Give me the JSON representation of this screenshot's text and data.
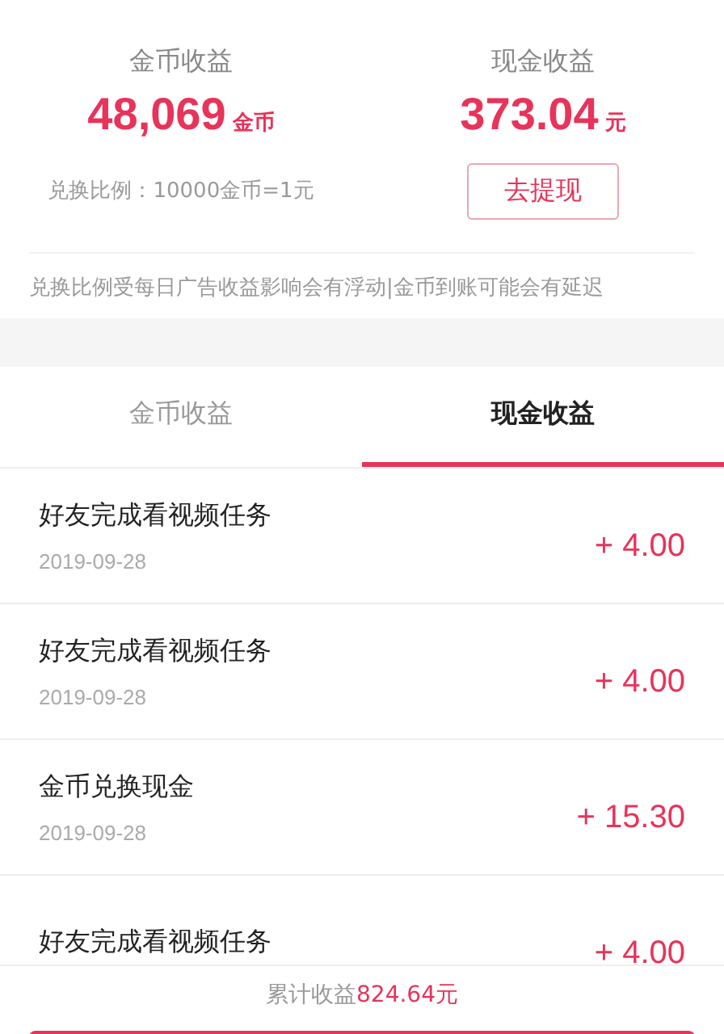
{
  "summary": [
    {
      "title": "金币收益",
      "amount": "48,069",
      "unit": "金币"
    },
    {
      "title": "现金收益",
      "amount": "373.04",
      "unit": "元"
    }
  ],
  "exchange_rate": "兑换比例：10000金币=1元",
  "withdraw_button": "去提现",
  "notice": "兑换比例受每日广告收益影响会有浮动|金币到账可能会有延迟",
  "tabs": [
    {
      "label": "金币收益",
      "selected": false
    },
    {
      "label": "现金收益",
      "selected": true
    }
  ],
  "records": [
    {
      "title": "好友完成看视频任务",
      "date": "2019-09-28",
      "amount": "+ 4.00"
    },
    {
      "title": "好友完成看视频任务",
      "date": "2019-09-28",
      "amount": "+ 4.00"
    },
    {
      "title": "金币兑换现金",
      "date": "2019-09-28",
      "amount": "+ 15.30"
    },
    {
      "title": "好友完成看视频任务",
      "amount": "+ 4.00"
    }
  ],
  "footer": {
    "label": "累计收益",
    "total": "824.64元"
  }
}
